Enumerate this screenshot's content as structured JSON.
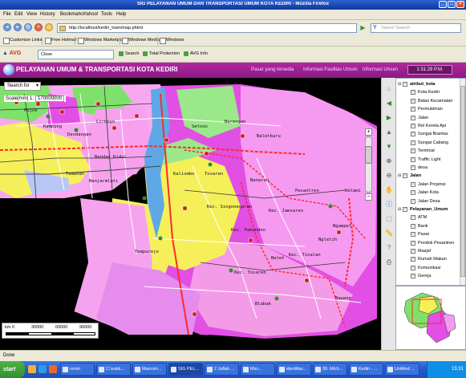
{
  "window": {
    "title": "SIG PELAYANAN UMUM DAN TRANSPORTASI UMUM KOTA KEDIRI - Mozilla Firefox"
  },
  "menu": [
    "File",
    "Edit",
    "View",
    "History",
    "Bookmarks",
    "Yahoo!",
    "Tools",
    "Help"
  ],
  "nav": {
    "url": "http://localhost/kediri_town/map.phtml",
    "search_placeholder": "Yahoo! Search"
  },
  "bookmarks": [
    "Customize Links",
    "Free Hotmail",
    "Windows Marketplace",
    "Windows Media",
    "Windows"
  ],
  "avg_toolbar": {
    "logo": "AVG",
    "input_value": "Close",
    "search_label": "Search",
    "protection_label": "Total Protection",
    "info_label": "AVG Info"
  },
  "app": {
    "title": "PELAYANAN UMUM & TRANSPORTASI KOTA KEDIRI",
    "nav": [
      "Pasar yang tersedia",
      "Informasi Fasilitas Umum",
      "Informasi Umum"
    ],
    "clock": "1:31:29 P.M."
  },
  "map": {
    "search_for": "Search for",
    "scale_label": "Scale[mm] 1:",
    "scale_value": "170000000",
    "scalebar_labels": [
      "km 0",
      "30000",
      "60000",
      "90000"
    ],
    "labels": [
      {
        "id": "pojok",
        "text": "Pojok"
      },
      {
        "id": "lirboyo",
        "text": "Lirboyo"
      },
      {
        "id": "kampung-dalem",
        "text": "Kampung"
      },
      {
        "id": "dandangan",
        "text": "Dandangan"
      },
      {
        "id": "bandar-kidul",
        "text": "Bandar Kidul"
      },
      {
        "id": "tamanan",
        "text": "Tamanan"
      },
      {
        "id": "banjarmlati",
        "text": "Banjarmlati"
      },
      {
        "id": "baletbaru",
        "text": "Baletbaru"
      },
      {
        "id": "burengan",
        "text": "Burengan"
      },
      {
        "id": "setono",
        "text": "Setono"
      },
      {
        "id": "kaliombo",
        "text": "Kaliombo"
      },
      {
        "id": "tosaren",
        "text": "Tosaren"
      },
      {
        "id": "banaran",
        "text": "Banaran"
      },
      {
        "id": "pesantren",
        "text": "Pesantren"
      },
      {
        "id": "ketami",
        "text": "Ketami"
      },
      {
        "id": "kec-singonegaran",
        "text": "Kec. Singonegaran"
      },
      {
        "id": "kec-jamsaren",
        "text": "Kec. Jamsaren"
      },
      {
        "id": "pakunden",
        "text": "Kec. Pakunden"
      },
      {
        "id": "ngletih",
        "text": "Ngletih"
      },
      {
        "id": "ngampel",
        "text": "Ngampel"
      },
      {
        "id": "betet",
        "text": "Betet"
      },
      {
        "id": "kec-tinalan",
        "text": "Kec. Tinalan"
      },
      {
        "id": "kec-tosaren",
        "text": "Kec. Tosaren"
      },
      {
        "id": "blabak",
        "text": "Blabak"
      },
      {
        "id": "bawang",
        "text": "Bawang"
      },
      {
        "id": "tempurejo",
        "text": "Tempurejo"
      }
    ]
  },
  "layers": [
    {
      "type": "group",
      "label": "atribut_kota",
      "checked": true
    },
    {
      "type": "item",
      "label": "Kota Kediri",
      "checked": true
    },
    {
      "type": "item",
      "label": "Batas Kecamatan",
      "checked": true
    },
    {
      "type": "item",
      "label": "Permukiman",
      "checked": true
    },
    {
      "type": "item",
      "label": "Jalan",
      "checked": true
    },
    {
      "type": "item",
      "label": "Rel Kereta Api",
      "checked": true
    },
    {
      "type": "item",
      "label": "Sungai Brantas",
      "checked": true
    },
    {
      "type": "item",
      "label": "Sungai Cabang",
      "checked": true
    },
    {
      "type": "item",
      "label": "Terminal",
      "checked": true
    },
    {
      "type": "item",
      "label": "Traffic Light",
      "checked": true
    },
    {
      "type": "item",
      "label": "desa",
      "checked": true
    },
    {
      "type": "group",
      "label": "Jalan",
      "checked": true
    },
    {
      "type": "item",
      "label": "Jalan Propinsi",
      "checked": true
    },
    {
      "type": "item",
      "label": "Jalan Kota",
      "checked": true
    },
    {
      "type": "item",
      "label": "Jalan Desa",
      "checked": true
    },
    {
      "type": "group",
      "label": "Pelayanan_Umum",
      "checked": true
    },
    {
      "type": "item",
      "label": "ATM",
      "checked": true
    },
    {
      "type": "item",
      "label": "Bank",
      "checked": true
    },
    {
      "type": "item",
      "label": "Pasar",
      "checked": true
    },
    {
      "type": "item",
      "label": "Pondok Pesantren",
      "checked": true
    },
    {
      "type": "item",
      "label": "Masjid",
      "checked": true
    },
    {
      "type": "item",
      "label": "Rumah Makan",
      "checked": true
    },
    {
      "type": "item",
      "label": "Komunikasi",
      "checked": true
    },
    {
      "type": "item",
      "label": "Gereja",
      "checked": true
    }
  ],
  "status": "Done",
  "taskbar": {
    "start": "start",
    "tasks": [
      "revisi",
      "C:\\sukk...",
      "Macrom...",
      "SIG PEL...",
      "2 Jaflah ...",
      "Micr...",
      "identifas...",
      "30. Mich...",
      "Kediri - ...",
      "Untitled ..."
    ],
    "active_index": 3,
    "clock": "15:31"
  },
  "colors": {
    "header": "#9b2191",
    "map_pink": "#f79cf0",
    "map_magenta": "#e24fe4",
    "map_green": "#7ee26a",
    "map_yellow": "#f5f05a",
    "map_blue": "#5fa8e6",
    "road_red": "#ff2a2a"
  },
  "icons": {
    "back": "back-arrow-icon",
    "forward": "forward-arrow-icon",
    "reload": "reload-icon",
    "stop": "stop-icon",
    "home": "home-icon"
  }
}
